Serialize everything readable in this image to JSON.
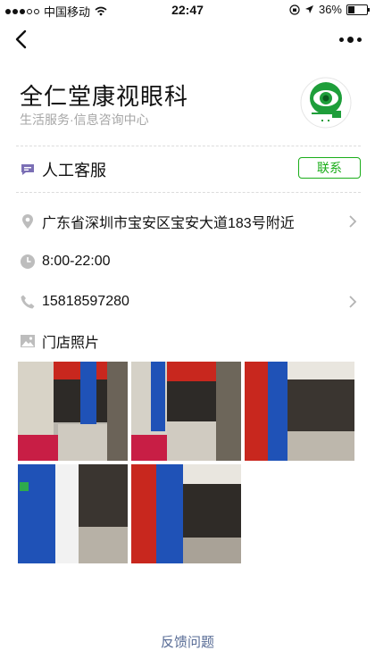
{
  "status_bar": {
    "carrier": "中国移动",
    "time": "22:47",
    "battery": "36%",
    "battery_level": 0.36
  },
  "nav": {
    "back_icon": "chevron-left-icon",
    "more_icon": "more-dots-icon"
  },
  "shop": {
    "name": "全仁堂康视眼科",
    "category": "生活服务·信息咨询中心"
  },
  "service": {
    "label": "人工客服",
    "contact_button": "联系"
  },
  "info": {
    "address": "广东省深圳市宝安区宝安大道183号附近",
    "hours": "8:00-22:00",
    "phone": "15818597280"
  },
  "photos": {
    "title": "门店照片",
    "count": 5
  },
  "feedback": "反馈问题",
  "colors": {
    "accent_green": "#1aad19",
    "link_blue": "#576b95",
    "muted": "#a6a6a6"
  }
}
